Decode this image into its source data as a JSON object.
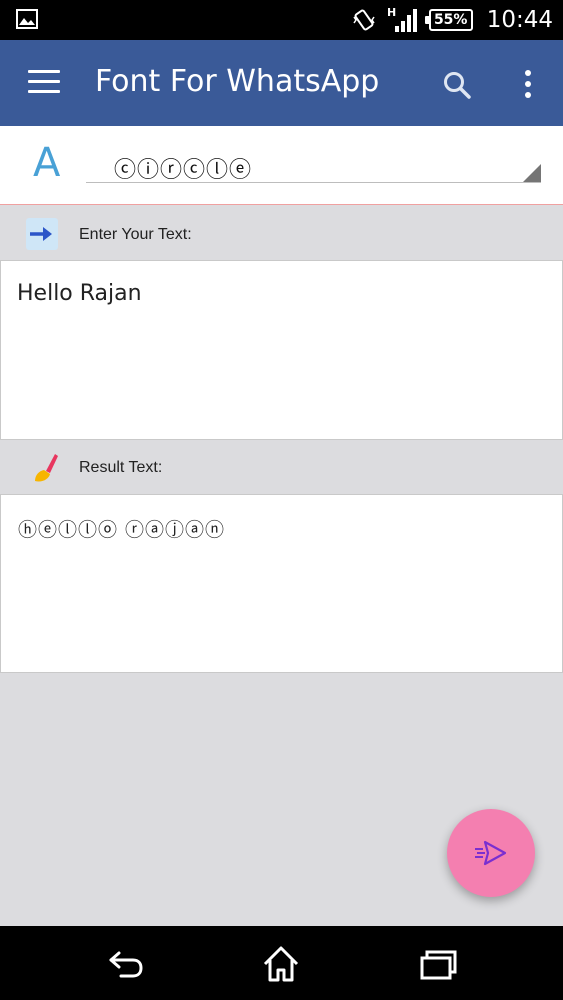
{
  "status_bar": {
    "time": "10:44",
    "battery": "55%",
    "network": "H"
  },
  "app_bar": {
    "title": "Font For WhatsApp"
  },
  "font_picker": {
    "selected": "ⓒⓘⓡⓒⓛⓔ",
    "icon_letter": "A"
  },
  "input_section": {
    "label": "Enter Your Text:",
    "value": "Hello Rajan"
  },
  "result_section": {
    "label": "Result Text:",
    "value": "ⓗⓔⓛⓛⓞ ⓡⓐⓙⓐⓝ"
  },
  "colors": {
    "app_bar": "#3a5a98",
    "fab": "#f47fb0",
    "font_icon": "#49a1d6",
    "background": "#dcdcdf"
  }
}
